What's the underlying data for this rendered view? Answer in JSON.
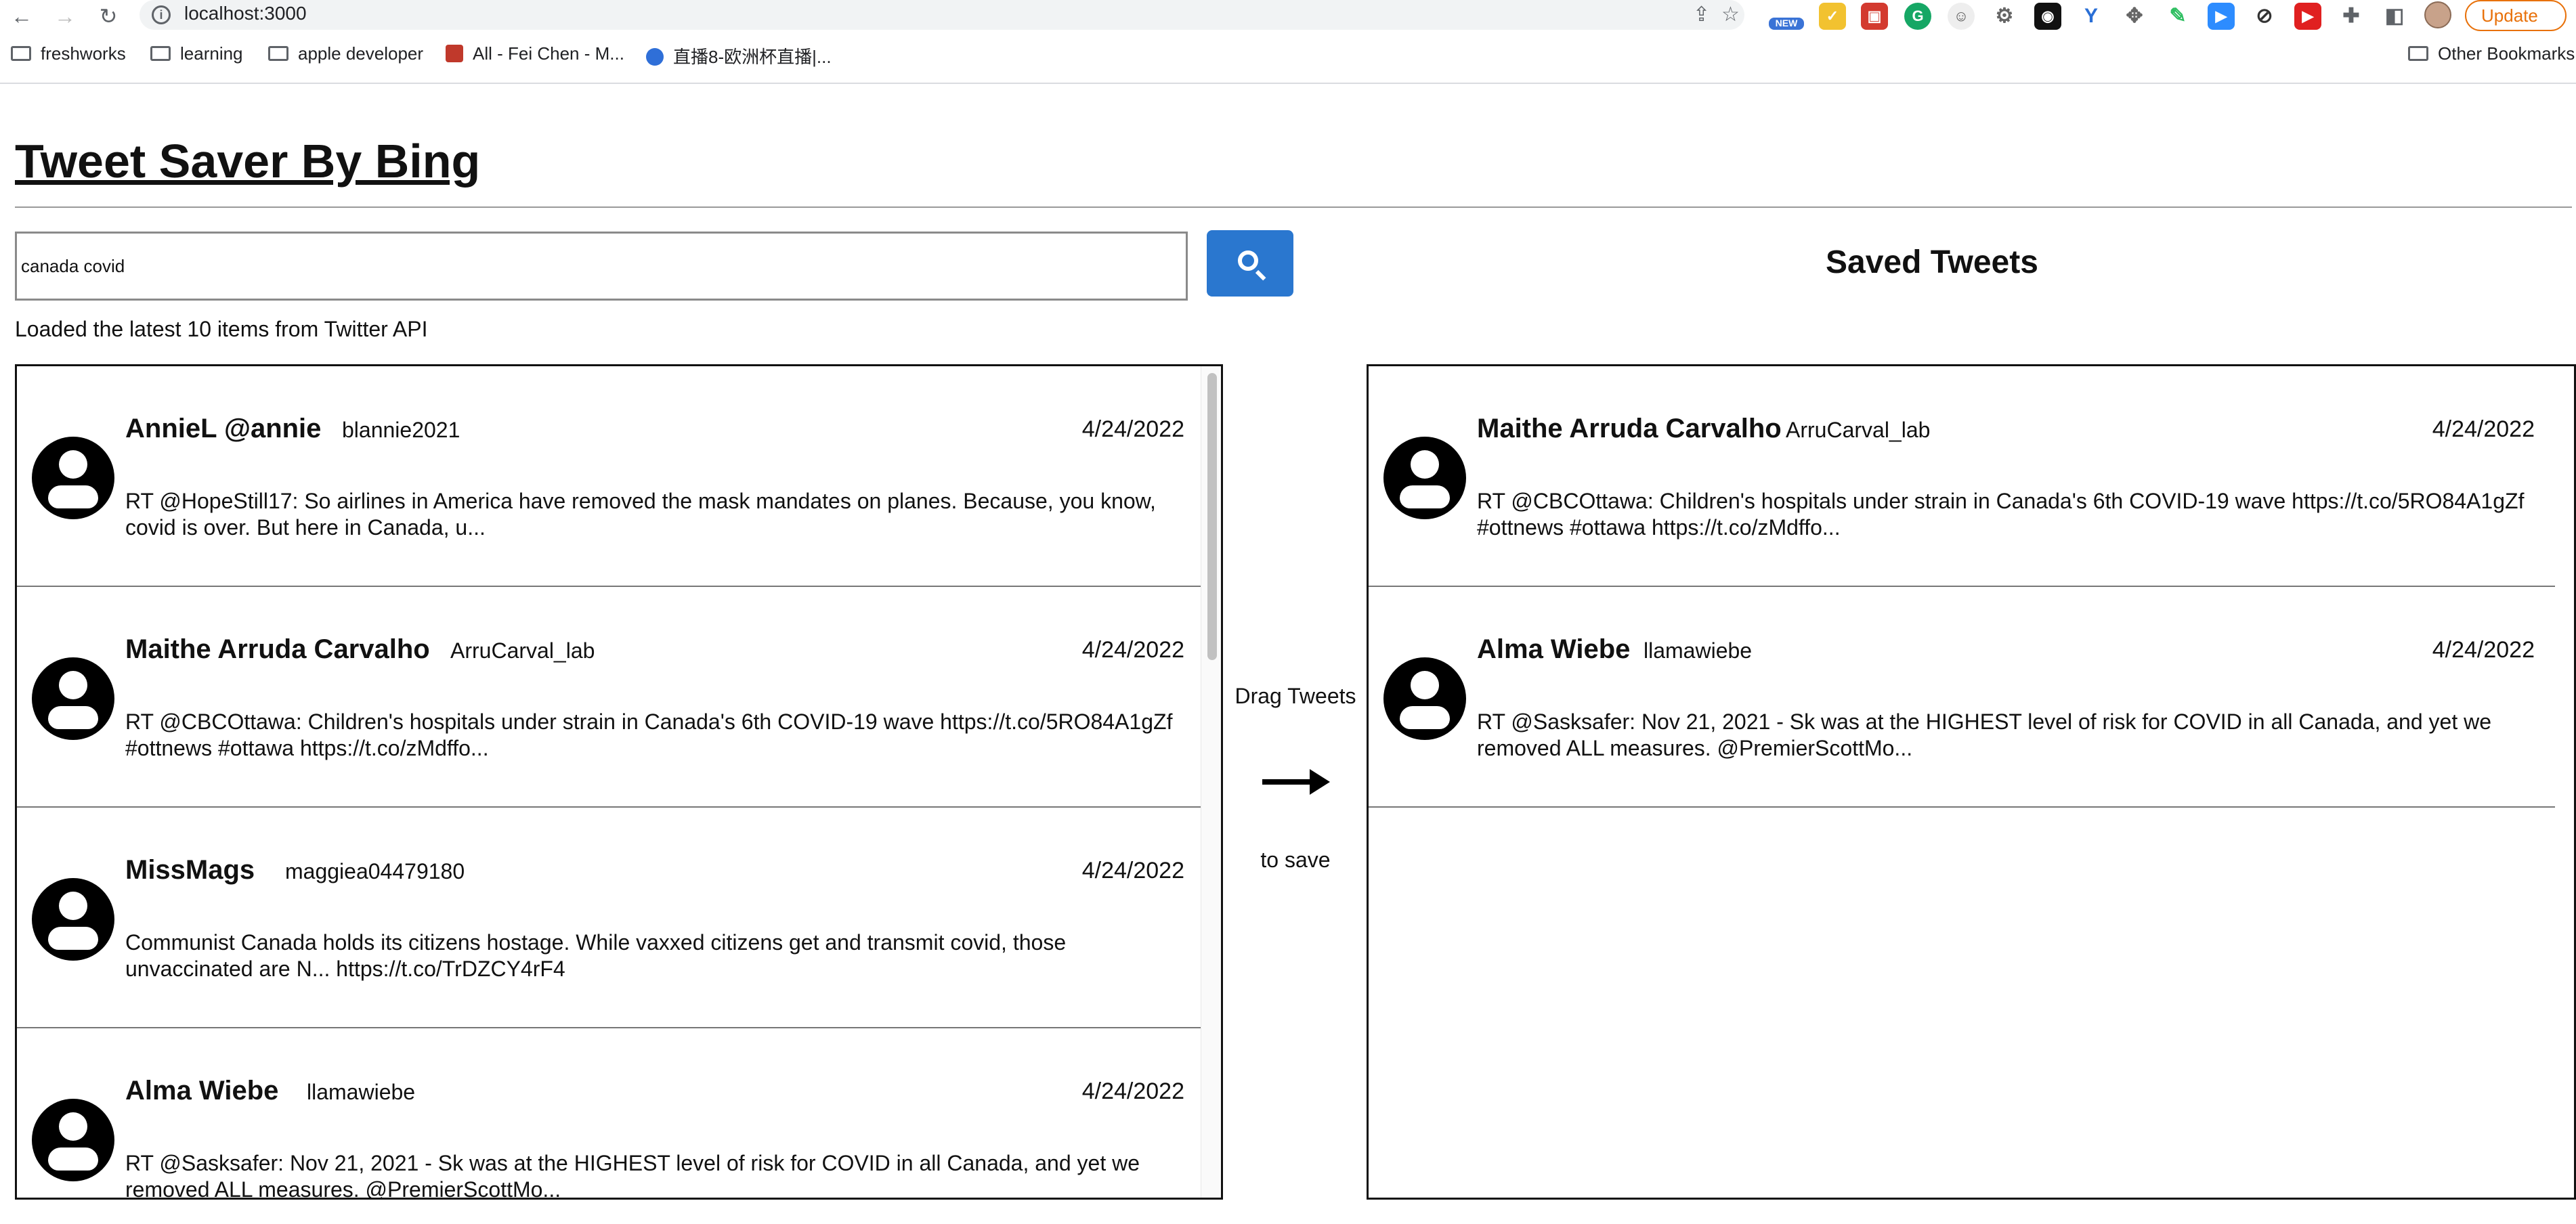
{
  "browser": {
    "url": "localhost:3000",
    "update_label": "Update",
    "ext_new_badge": "NEW",
    "bookmarks": [
      {
        "label": "freshworks",
        "type": "folder"
      },
      {
        "label": "learning",
        "type": "folder"
      },
      {
        "label": "apple developer",
        "type": "folder"
      },
      {
        "label": "All - Fei Chen - M...",
        "type": "site"
      },
      {
        "label": "直播8-欧洲杯直播|...",
        "type": "site"
      }
    ],
    "other_bookmarks": "Other Bookmarks"
  },
  "app": {
    "title": "Tweet Saver By Bing",
    "search": {
      "value": "canada covid"
    },
    "status": "Loaded the latest 10 items from Twitter API",
    "saved_title": "Saved Tweets",
    "drag_hint": "Drag Tweets",
    "save_hint": "to save"
  },
  "results": [
    {
      "name": "AnnieL @annie",
      "handle": "blannie2021",
      "date": "4/24/2022",
      "text": "RT @HopeStill17: So airlines in America have removed the mask mandates on planes. Because, you know, covid is over. But here in Canada, u..."
    },
    {
      "name": "Maithe Arruda Carvalho",
      "handle": "ArruCarval_lab",
      "date": "4/24/2022",
      "text": "RT @CBCOttawa: Children's hospitals under strain in Canada's 6th COVID-19 wave https://t.co/5RO84A1gZf #ottnews #ottawa https://t.co/zMdffo..."
    },
    {
      "name": "MissMags",
      "handle": "maggiea04479180",
      "date": "4/24/2022",
      "text": "Communist Canada holds its citizens hostage. While vaxxed citizens get and transmit covid, those unvaccinated are N... https://t.co/TrDZCY4rF4"
    },
    {
      "name": "Alma Wiebe",
      "handle": "llamawiebe",
      "date": "4/24/2022",
      "text": "RT @Sasksafer: Nov 21, 2021 - Sk was at the HIGHEST level of risk for COVID in all Canada, and yet we removed ALL measures. @PremierScottMo..."
    }
  ],
  "saved": [
    {
      "name": "Maithe Arruda Carvalho",
      "handle": "ArruCarval_lab",
      "date": "4/24/2022",
      "text": "RT @CBCOttawa: Children's hospitals under strain in Canada's 6th COVID-19 wave https://t.co/5RO84A1gZf #ottnews #ottawa https://t.co/zMdffo..."
    },
    {
      "name": "Alma Wiebe",
      "handle": "llamawiebe",
      "date": "4/24/2022",
      "text": "RT @Sasksafer: Nov 21, 2021 - Sk was at the HIGHEST level of risk for COVID in all Canada, and yet we removed ALL measures. @PremierScottMo..."
    }
  ]
}
